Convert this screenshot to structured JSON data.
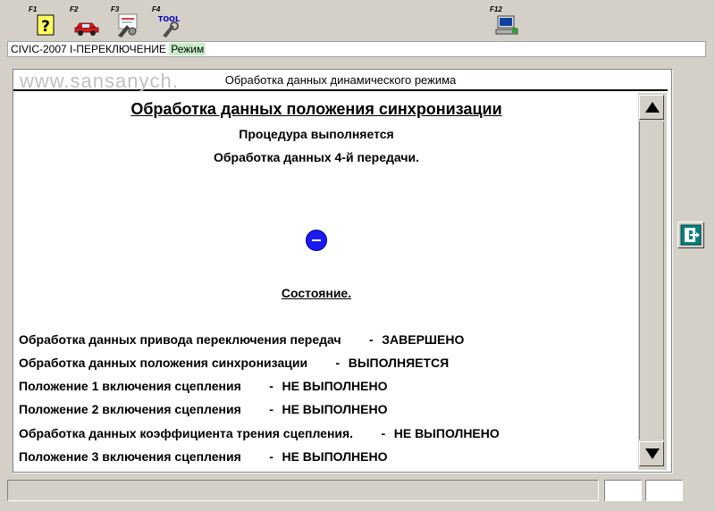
{
  "toolbar": {
    "keys": [
      {
        "label": "F1",
        "icon": "help-icon"
      },
      {
        "label": "F2",
        "icon": "car-icon"
      },
      {
        "label": "F3",
        "icon": "diagnostic-icon"
      },
      {
        "label": "F4",
        "icon": "tool-icon"
      },
      {
        "label": "F12",
        "icon": "computer-icon"
      }
    ],
    "tool_icon_text": "TOOL"
  },
  "breadcrumb": {
    "path": "CIVIC-2007 I-ПЕРЕКЛЮЧЕНИЕ",
    "mode": "Режим"
  },
  "watermark": "www.sansanych.",
  "panel": {
    "header": "Обработка данных динамического режима",
    "title": "Обработка данных положения синхронизации",
    "procedure": "Процедура выполняется",
    "gear_step": "Обработка данных 4-й передачи.",
    "status_heading": "Состояние.",
    "dash": "-",
    "rows": [
      {
        "label": "Обработка данных привода переключения передач",
        "status": "ЗАВЕРШЕНО"
      },
      {
        "label": "Обработка данных положения синхронизации",
        "status": "ВЫПОЛНЯЕТСЯ"
      },
      {
        "label": "Положение 1 включения сцепления",
        "status": "НЕ ВЫПОЛНЕНО"
      },
      {
        "label": "Положение 2 включения сцепления",
        "status": "НЕ ВЫПОЛНЕНО"
      },
      {
        "label": "Обработка данных коэффициента трения сцепления.",
        "status": "НЕ ВЫПОЛНЕНО"
      },
      {
        "label": "Положение 3 включения сцепления",
        "status": "НЕ ВЫПОЛНЕНО"
      }
    ]
  },
  "colors": {
    "spinner": "#1a1af0",
    "exit_icon": "#008080",
    "mode_highlight": "#c8f0c8"
  }
}
